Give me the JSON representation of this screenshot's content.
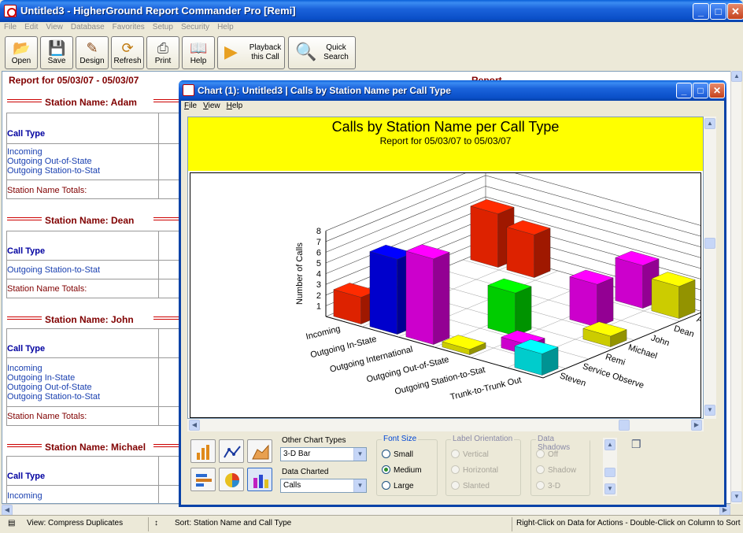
{
  "window": {
    "title": "Untitled3 - HigherGround Report Commander Pro [Remi]"
  },
  "menu": [
    "File",
    "Edit",
    "View",
    "Database",
    "Favorites",
    "Setup",
    "Security",
    "Help"
  ],
  "toolbar": {
    "open": "Open",
    "save": "Save",
    "design": "Design",
    "refresh": "Refresh",
    "print": "Print",
    "help": "Help",
    "playback": "Playback this Call",
    "quick_search": "Quick Search"
  },
  "report": {
    "header": "Report for 05/03/07 - 05/03/07",
    "header_right": "Report",
    "col_label": "Call Type",
    "totals_label": "Station Name Totals:",
    "sections": [
      {
        "title": "Station Name: Adam",
        "rows": [
          "Incoming",
          "Outgoing Out-of-State",
          "Outgoing Station-to-Stat"
        ]
      },
      {
        "title": "Station Name: Dean",
        "rows": [
          "Outgoing Station-to-Stat"
        ]
      },
      {
        "title": "Station Name: John",
        "rows": [
          "Incoming",
          "Outgoing In-State",
          "Outgoing Out-of-State",
          "Outgoing Station-to-Stat"
        ]
      },
      {
        "title": "Station Name: Michael",
        "rows": [
          "Incoming"
        ]
      }
    ]
  },
  "chart_window": {
    "title": "Chart (1): Untitled3 | Calls by Station Name per Call Type",
    "menu": [
      "File",
      "View",
      "Help"
    ]
  },
  "controls": {
    "other_chart_types_label": "Other Chart Types",
    "other_chart_types_value": "3-D Bar",
    "data_charted_label": "Data Charted",
    "data_charted_value": "Calls",
    "font_size": {
      "legend": "Font Size",
      "options": [
        "Small",
        "Medium",
        "Large"
      ],
      "selected": "Medium"
    },
    "label_orientation": {
      "legend": "Label Orientation",
      "options": [
        "Vertical",
        "Horizontal",
        "Slanted"
      ]
    },
    "data_shadows": {
      "legend": "Data Shadows",
      "options": [
        "Off",
        "Shadow",
        "3-D"
      ]
    }
  },
  "status": {
    "view": "View: Compress Duplicates",
    "sort": "Sort: Station Name and Call Type",
    "hint": "Right-Click on Data for Actions - Double-Click on Column to Sort"
  },
  "chart_data": {
    "type": "bar",
    "style": "3-D Bar",
    "title": "Calls by Station Name per Call Type",
    "subtitle": "Report for 05/03/07 to 05/03/07",
    "ylabel": "Number of Calls",
    "ylim": [
      0,
      8
    ],
    "yticks": [
      1,
      2,
      3,
      4,
      5,
      6,
      7,
      8
    ],
    "call_types": [
      "Incoming",
      "Outgoing In-State",
      "Outgoing International",
      "Outgoing Out-of-State",
      "Outgoing Station-to-Stat",
      "Trunk-to-Trunk Out"
    ],
    "stations": [
      "Adam",
      "Dean",
      "John",
      "Michael",
      "Remi",
      "Service Observe",
      "Steven"
    ],
    "bars": [
      {
        "call_type": "Incoming",
        "station": "Adam",
        "value": 5,
        "color": "#dd2200"
      },
      {
        "call_type": "Incoming",
        "station": "Steven",
        "value": 2.5,
        "color": "#dd2200"
      },
      {
        "call_type": "Outgoing In-State",
        "station": "Adam",
        "value": 4,
        "color": "#dd2200"
      },
      {
        "call_type": "Outgoing In-State",
        "station": "Steven",
        "value": 7,
        "color": "#0000cc"
      },
      {
        "call_type": "Outgoing International",
        "station": "Steven",
        "value": 8,
        "color": "#cc00cc"
      },
      {
        "call_type": "Outgoing Out-of-State",
        "station": "Remi",
        "value": 4,
        "color": "#00cc00"
      },
      {
        "call_type": "Outgoing Out-of-State",
        "station": "Steven",
        "value": 0.5,
        "color": "#cccc00"
      },
      {
        "call_type": "Outgoing Station-to-Stat",
        "station": "John",
        "value": 4,
        "color": "#cc00cc"
      },
      {
        "call_type": "Outgoing Station-to-Stat",
        "station": "Adam",
        "value": 4,
        "color": "#cc00cc"
      },
      {
        "call_type": "Outgoing Station-to-Stat",
        "station": "Service Observe",
        "value": 1,
        "color": "#cc00cc"
      },
      {
        "call_type": "Trunk-to-Trunk Out",
        "station": "Steven",
        "value": 2,
        "color": "#00cccc"
      },
      {
        "call_type": "Trunk-to-Trunk Out",
        "station": "Adam",
        "value": 3,
        "color": "#cccc00"
      },
      {
        "call_type": "Trunk-to-Trunk Out",
        "station": "Michael",
        "value": 1,
        "color": "#cccc00"
      }
    ]
  }
}
